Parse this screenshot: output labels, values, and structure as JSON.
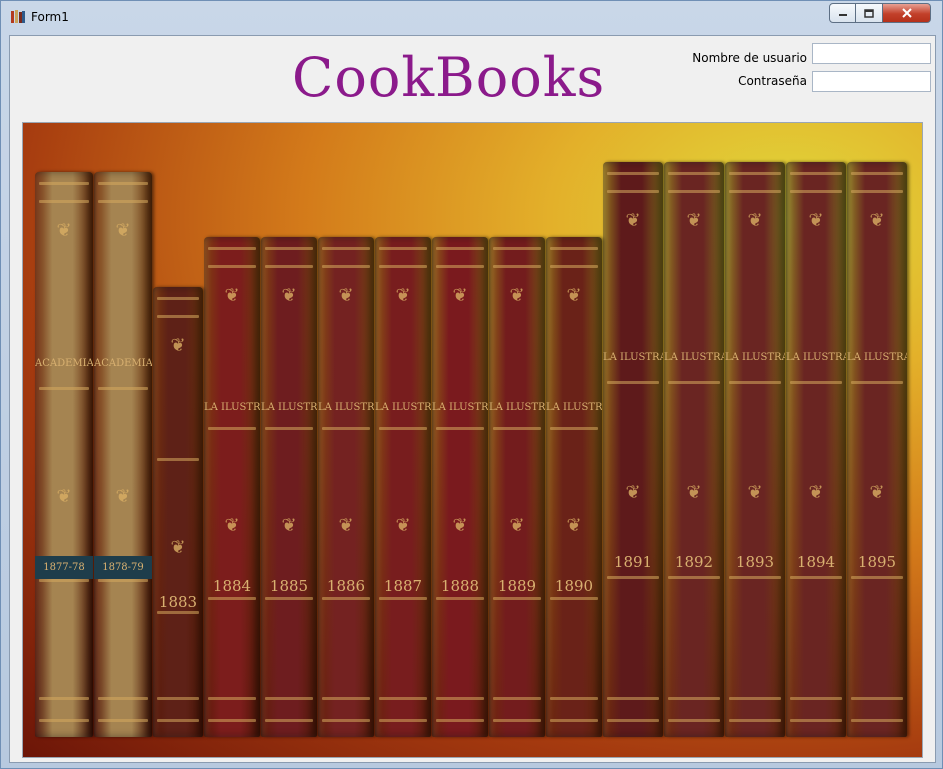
{
  "window": {
    "title": "Form1",
    "icon": "app-books-icon",
    "controls": [
      "minimize-icon",
      "maximize-icon",
      "close-icon"
    ]
  },
  "header": {
    "logo_text": "CookBooks",
    "logo_color": "#8b1a8b"
  },
  "login": {
    "username_label": "Nombre de usuario",
    "username_value": "",
    "password_label": "Contraseña",
    "password_value": ""
  },
  "picture": {
    "subject": "bookshelf-image",
    "books": [
      {
        "title": "ACADEMIA",
        "year": "1877-78",
        "color": "#a58451",
        "kind": "tall"
      },
      {
        "title": "ACADEMIA",
        "year": "1878-79",
        "color": "#a58451",
        "kind": "tall"
      },
      {
        "title": "",
        "year": "1883",
        "color": "#5e2117",
        "kind": "short"
      },
      {
        "title": "LA ILUSTRACION IBERICA",
        "year": "1884",
        "color": "#7c1d1c",
        "kind": "mid"
      },
      {
        "title": "LA ILUSTRACION IBERICA",
        "year": "1885",
        "color": "#6e1d1f",
        "kind": "mid"
      },
      {
        "title": "LA ILUSTRACION IBERICA",
        "year": "1886",
        "color": "#742221",
        "kind": "mid"
      },
      {
        "title": "LA ILUSTRACION IBERICA",
        "year": "1887",
        "color": "#781d1e",
        "kind": "mid"
      },
      {
        "title": "LA ILUSTRACION IBERICA",
        "year": "1888",
        "color": "#7a1a1e",
        "kind": "mid"
      },
      {
        "title": "LA ILUSTRACION IBERICA",
        "year": "1889",
        "color": "#731c1d",
        "kind": "mid"
      },
      {
        "title": "LA ILUSTRACION IBERICA",
        "year": "1890",
        "color": "#6a2218",
        "kind": "mid"
      },
      {
        "title": "LA ILUSTRACION IBERICA",
        "year": "1891",
        "color": "#5e1a1b",
        "kind": "tall2"
      },
      {
        "title": "LA ILUSTRACION IBERICA",
        "year": "1892",
        "color": "#6a2522",
        "kind": "tall2"
      },
      {
        "title": "LA ILUSTRACION IBERICA",
        "year": "1893",
        "color": "#6a2522",
        "kind": "tall2"
      },
      {
        "title": "LA ILUSTRACION IBERICA",
        "year": "1894",
        "color": "#6a2522",
        "kind": "tall2"
      },
      {
        "title": "LA ILUSTRACION IBERICA",
        "year": "1895",
        "color": "#6a2522",
        "kind": "tall2"
      }
    ]
  }
}
